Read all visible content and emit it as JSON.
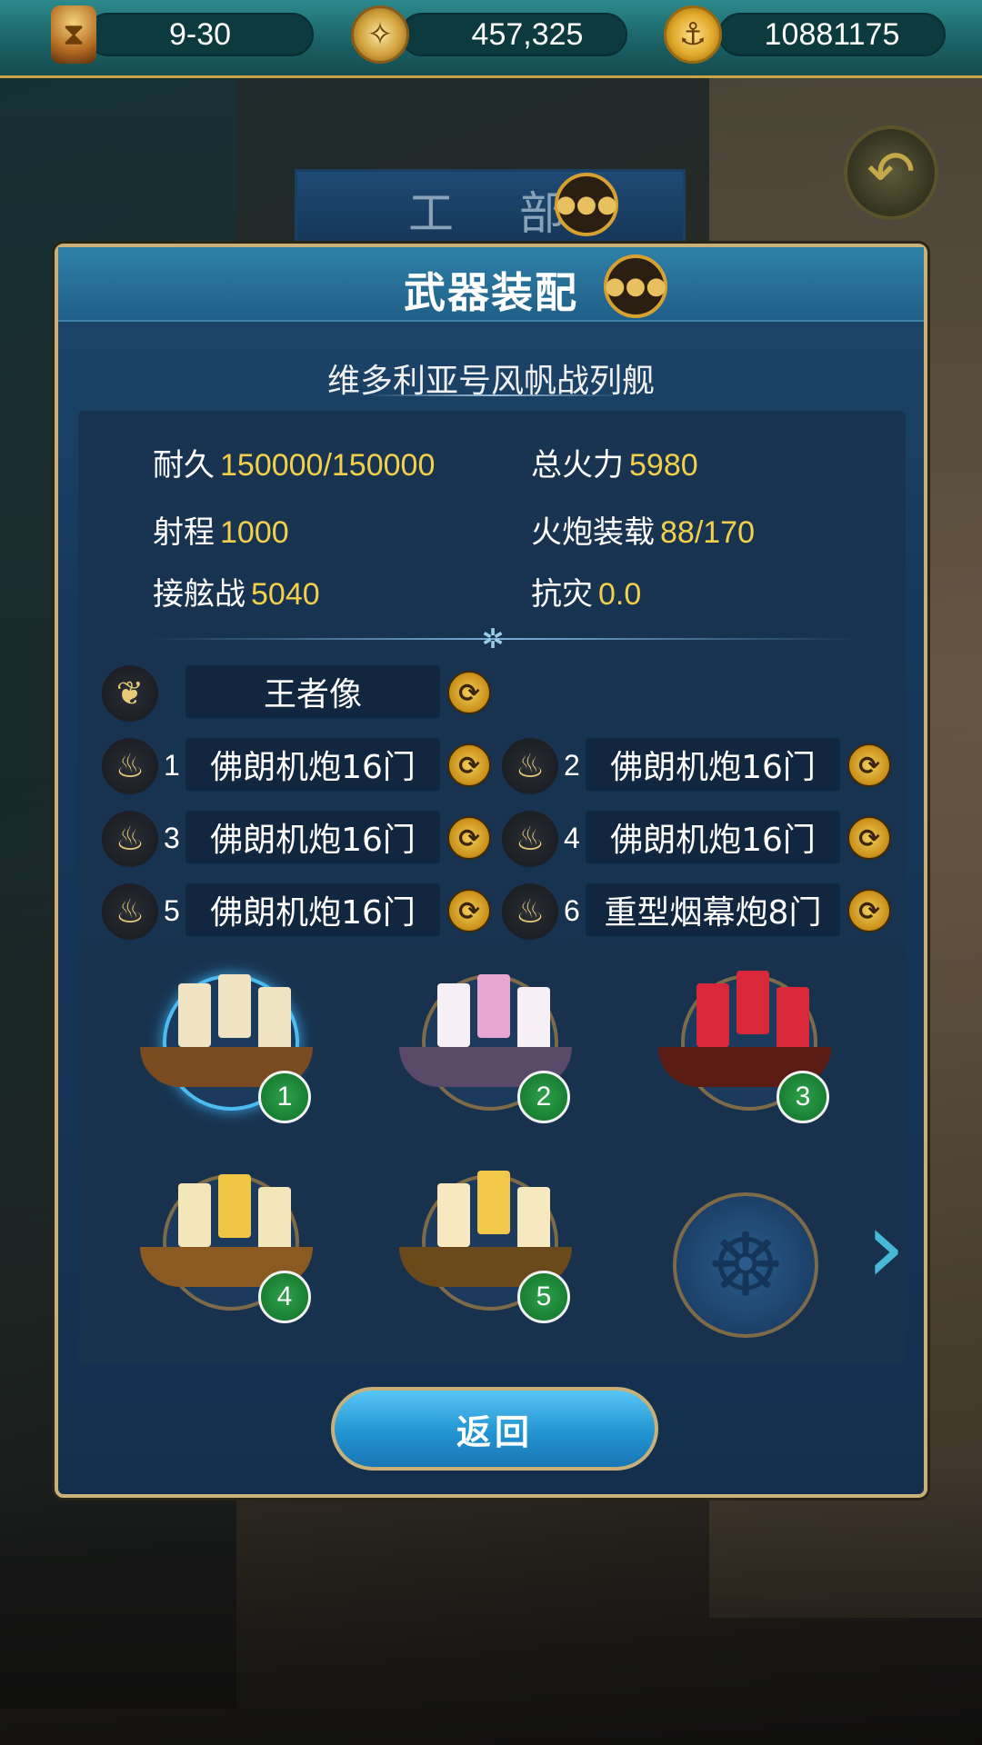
{
  "resources": {
    "date": "9-30",
    "compass_value": "457,325",
    "gold_value": "10881175"
  },
  "department": {
    "title": "工 部"
  },
  "panel": {
    "title": "武器装配",
    "ship_name": "维多利亚号风帆战列舰"
  },
  "stats": [
    {
      "label": "耐久",
      "value": "150000/150000"
    },
    {
      "label": "总火力",
      "value": "5980"
    },
    {
      "label": "射程",
      "value": "1000"
    },
    {
      "label": "火炮装载",
      "value": "88/170"
    },
    {
      "label": "接舷战",
      "value": "5040"
    },
    {
      "label": "抗灾",
      "value": "0.0"
    }
  ],
  "figurehead": {
    "name": "王者像"
  },
  "cannons": [
    {
      "num": "1",
      "name": "佛朗机炮16门"
    },
    {
      "num": "2",
      "name": "佛朗机炮16门"
    },
    {
      "num": "3",
      "name": "佛朗机炮16门"
    },
    {
      "num": "4",
      "name": "佛朗机炮16门"
    },
    {
      "num": "5",
      "name": "佛朗机炮16门"
    },
    {
      "num": "6",
      "name": "重型烟幕炮8门"
    }
  ],
  "fleet": [
    {
      "badge": "1"
    },
    {
      "badge": "2"
    },
    {
      "badge": "3"
    },
    {
      "badge": "4"
    },
    {
      "badge": "5"
    }
  ],
  "buttons": {
    "return_label": "返回"
  },
  "icons": {
    "hourglass": "hourglass-icon",
    "compass": "compass-icon",
    "gold": "anchor-coin-icon",
    "back": "back-arrow-icon",
    "chat": "chat-bubble-icon",
    "wings": "wings-icon",
    "cannon": "cannon-icon",
    "swap": "swap-icon",
    "helm": "ship-wheel-icon"
  }
}
